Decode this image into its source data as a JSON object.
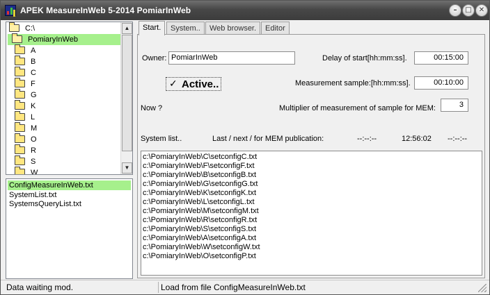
{
  "window": {
    "title": "APEK MeasureInWeb 5-2014 PomiarInWeb",
    "icon": "app-chart-icon",
    "controls": [
      "minimize",
      "maximize",
      "close"
    ]
  },
  "tree": {
    "root": "C:\\",
    "selected": "PomiaryInWeb",
    "folders": [
      "A",
      "B",
      "C",
      "F",
      "G",
      "K",
      "L",
      "M",
      "O",
      "R",
      "S",
      "W"
    ]
  },
  "files": [
    "ConfigMeasureInWeb.txt",
    "SystemList.txt",
    "SystemsQueryList.txt"
  ],
  "tabs": [
    "Start.",
    "System..",
    "Web browser.",
    "Editor"
  ],
  "start": {
    "owner_label": "Owner:",
    "owner_value": "PomiarInWeb",
    "delay_label": "Delay of start[hh:mm:ss].",
    "delay_value": "00:15:00",
    "active_label": "Active..",
    "active_checked": true,
    "sample_label": "Measurement sample:[hh:mm:ss].",
    "sample_value": "00:10:00",
    "now_label": "Now ?",
    "multiplier_label": "Multiplier of  measurement of sample for MEM:",
    "multiplier_value": "3",
    "system_list_label": "System list..",
    "publication_label": "Last  /  next / for MEM   publication:",
    "pub_last": "--:--:--",
    "pub_next": "12:56:02",
    "pub_mem": "--:--:--",
    "system_list": [
      "c:\\PomiaryInWeb\\C\\setconfigC.txt",
      "c:\\PomiaryInWeb\\F\\setconfigF.txt",
      "c:\\PomiaryInWeb\\B\\setconfigB.txt",
      "c:\\PomiaryInWeb\\G\\setconfigG.txt",
      "c:\\PomiaryInWeb\\K\\setconfigK.txt",
      "c:\\PomiaryInWeb\\L\\setconfigL.txt",
      "c:\\PomiaryInWeb\\M\\setconfigM.txt",
      "c:\\PomiaryInWeb\\R\\setconfigR.txt",
      "c:\\PomiaryInWeb\\S\\setconfigS.txt",
      "c:\\PomiaryInWeb\\A\\setconfigA.txt",
      "c:\\PomiaryInWeb\\W\\setconfigW.txt",
      "c:\\PomiaryInWeb\\O\\setconfigP.txt"
    ]
  },
  "status": {
    "left": "Data waiting mod.",
    "right": "Load from file ConfigMeasureInWeb.txt"
  },
  "colors": {
    "selection": "#a6f08c",
    "titlebar": "#474747",
    "folder": "#ffe680"
  }
}
